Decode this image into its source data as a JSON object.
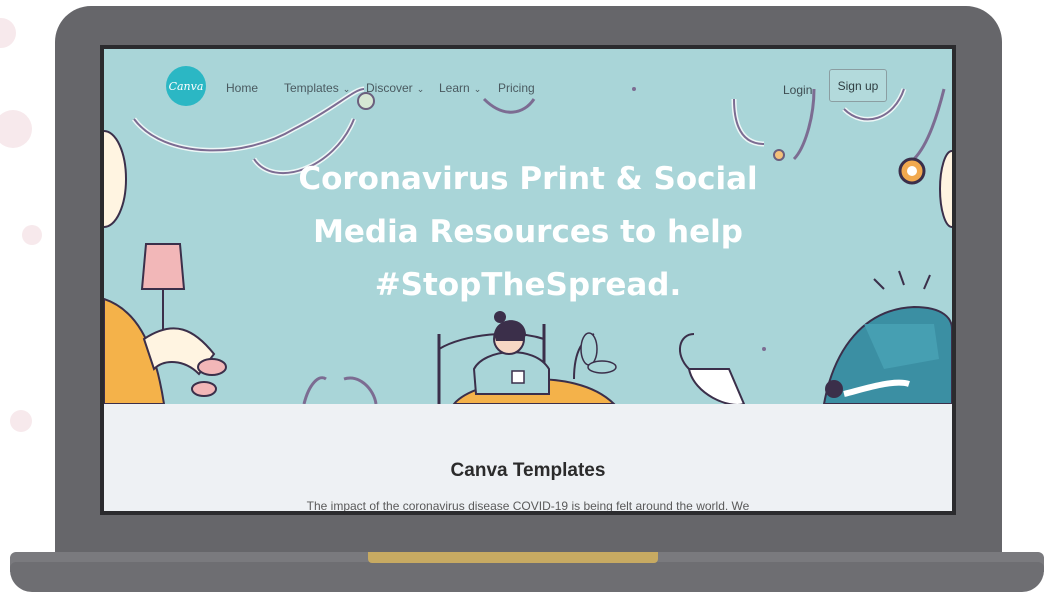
{
  "nav": {
    "logo_text": "Canva",
    "items": [
      {
        "label": "Home",
        "caret": ""
      },
      {
        "label": "Templates",
        "caret": "⌄"
      },
      {
        "label": "Discover",
        "caret": "⌄"
      },
      {
        "label": "Learn",
        "caret": "⌄"
      },
      {
        "label": "Pricing",
        "caret": ""
      }
    ],
    "login_label": "Login",
    "signup_label": "Sign up"
  },
  "hero": {
    "title": "Coronavirus Print & Social Media Resources to help #StopTheSpread."
  },
  "section": {
    "title": "Canva Templates",
    "text": "The impact of the coronavirus disease COVID-19 is being felt around the world. We"
  },
  "colors": {
    "hero_background": "#a9d5d8",
    "logo_background": "#2bb7c4",
    "laptop_body": "#66666a",
    "hinge": "#c7aa62"
  }
}
